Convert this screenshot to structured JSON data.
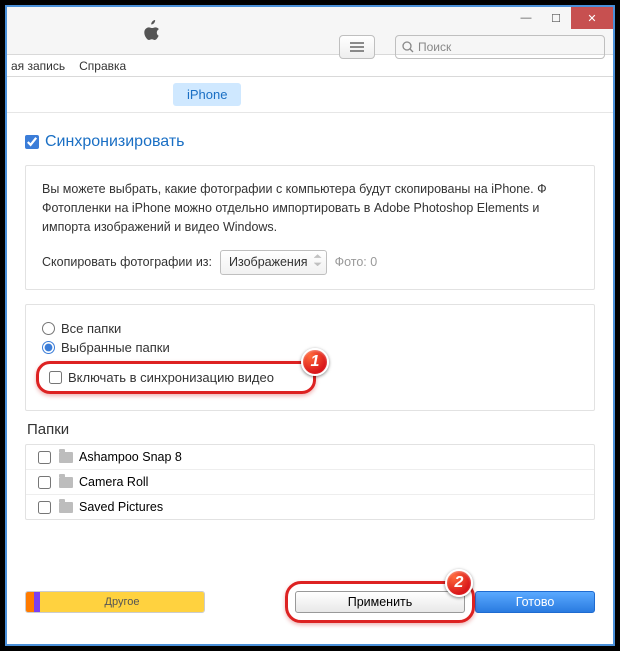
{
  "titlebar": {
    "search_placeholder": "Поиск"
  },
  "menubar": {
    "item1": "ая запись",
    "item2": "Справка"
  },
  "tabs": {
    "iphone": "iPhone"
  },
  "sync": {
    "checkbox_checked": true,
    "title": "Синхронизировать"
  },
  "info": {
    "line1": "Вы можете выбрать, какие фотографии с компьютера будут скопированы на iPhone. Ф",
    "line2": "Фотопленки на iPhone можно отдельно импортировать в Adobe Photoshop Elements и",
    "line3": "импорта изображений и видео Windows.",
    "copy_label": "Скопировать фотографии из:",
    "copy_source": "Изображения",
    "photo_count": "Фото: 0"
  },
  "folder_scope": {
    "all": "Все папки",
    "selected": "Выбранные папки",
    "include_video": "Включать в синхронизацию видео"
  },
  "annotations": {
    "badge1": "1",
    "badge2": "2"
  },
  "folders": {
    "title": "Папки",
    "items": [
      {
        "name": "Ashampoo Snap 8"
      },
      {
        "name": "Camera Roll"
      },
      {
        "name": "Saved Pictures"
      }
    ]
  },
  "bottom": {
    "storage_other": "Другое",
    "apply": "Применить",
    "done": "Готово"
  }
}
